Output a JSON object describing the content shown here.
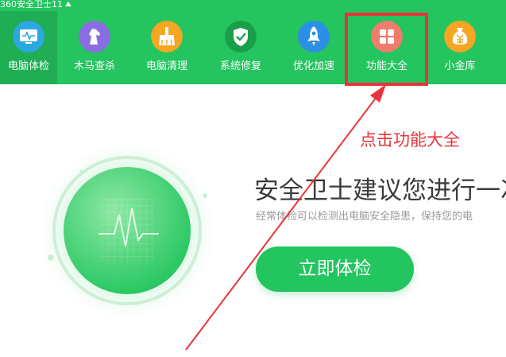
{
  "app": {
    "title": "360安全卫士11"
  },
  "nav": {
    "items": [
      {
        "label": "电脑体检",
        "icon": "monitor-icon",
        "color": "#2aa8e0",
        "active": true
      },
      {
        "label": "木马查杀",
        "icon": "horse-icon",
        "color": "#8a6de0"
      },
      {
        "label": "电脑清理",
        "icon": "broom-icon",
        "color": "#f5a623"
      },
      {
        "label": "系统修复",
        "icon": "shield-icon",
        "color": "#1a9e4a"
      },
      {
        "label": "优化加速",
        "icon": "rocket-icon",
        "color": "#2b8fe6"
      },
      {
        "label": "功能大全",
        "icon": "grid-icon",
        "color": "#f07c6c"
      },
      {
        "label": "小金库",
        "icon": "money-bag-icon",
        "color": "#f5a623"
      }
    ]
  },
  "annotation": {
    "text": "点击功能大全",
    "color": "#e8343a"
  },
  "main": {
    "headline": "安全卫士建议您进行一次",
    "subtext": "经常体检可以检测出电脑安全隐患，保持您的电",
    "scan_button": "立即体检"
  },
  "colors": {
    "brand": "#24c45f",
    "accent": "#22c55e"
  }
}
